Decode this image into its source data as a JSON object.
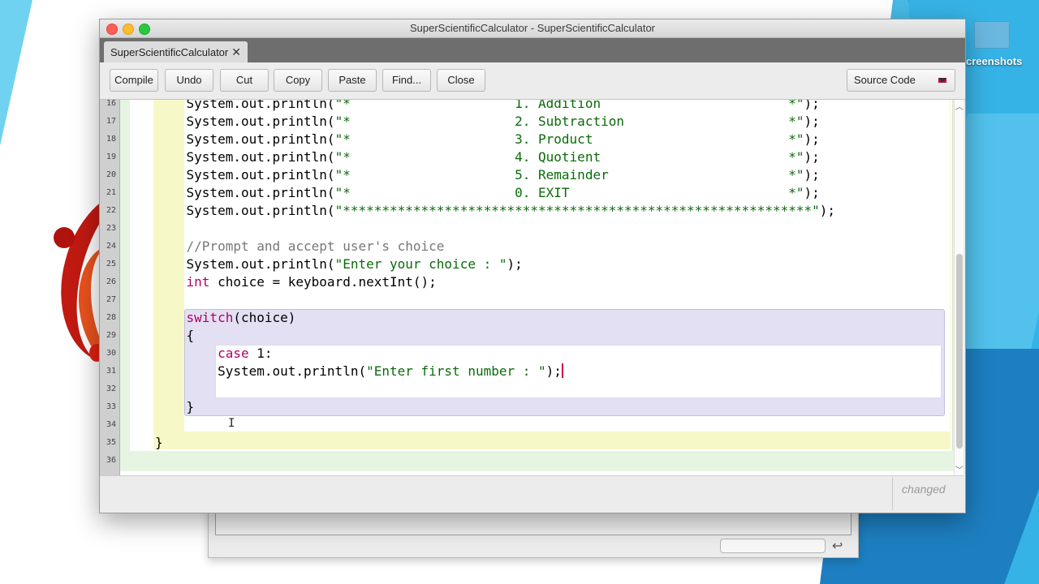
{
  "desktop": {
    "icon_label": "creenshots",
    "icon_name": "folder-icon"
  },
  "window": {
    "title": "SuperScientificCalculator - SuperScientificCalculator",
    "tab_label": "SuperScientificCalculator",
    "tab_close": "✕"
  },
  "toolbar": {
    "compile": "Compile",
    "undo": "Undo",
    "cut": "Cut",
    "copy": "Copy",
    "paste": "Paste",
    "find": "Find...",
    "close": "Close",
    "view_select": "Source Code"
  },
  "editor": {
    "lines": [
      {
        "num": "16",
        "code": "    System.out.println(\"*                     1. Addition                        *\");"
      },
      {
        "num": "17",
        "code": "    System.out.println(\"*                     2. Subtraction                     *\");"
      },
      {
        "num": "18",
        "code": "    System.out.println(\"*                     3. Product                         *\");"
      },
      {
        "num": "19",
        "code": "    System.out.println(\"*                     4. Quotient                        *\");"
      },
      {
        "num": "20",
        "code": "    System.out.println(\"*                     5. Remainder                       *\");"
      },
      {
        "num": "21",
        "code": "    System.out.println(\"*                     0. EXIT                            *\");"
      },
      {
        "num": "22",
        "code": "    System.out.println(\"************************************************************\");"
      },
      {
        "num": "23",
        "code": ""
      },
      {
        "num": "24",
        "code": "    //Prompt and accept user's choice"
      },
      {
        "num": "25",
        "code": "    System.out.println(\"Enter your choice : \");"
      },
      {
        "num": "26",
        "code": "    int choice = keyboard.nextInt();"
      },
      {
        "num": "27",
        "code": ""
      },
      {
        "num": "28",
        "code": "    switch(choice)"
      },
      {
        "num": "29",
        "code": "    {"
      },
      {
        "num": "30",
        "code": "        case 1:"
      },
      {
        "num": "31",
        "code": "        System.out.println(\"Enter first number : \");"
      },
      {
        "num": "32",
        "code": ""
      },
      {
        "num": "33",
        "code": "    }"
      },
      {
        "num": "34",
        "code": ""
      },
      {
        "num": "35",
        "code": "}"
      },
      {
        "num": "36",
        "code": ""
      }
    ]
  },
  "status": {
    "text": "changed"
  },
  "colors": {
    "string": "#0a6a0a",
    "keyword": "#b0006a",
    "comment": "#777777",
    "method_scope": "#f7f8c8",
    "class_scope": "#e6f5e1",
    "switch_scope": "#e3e0f4"
  }
}
